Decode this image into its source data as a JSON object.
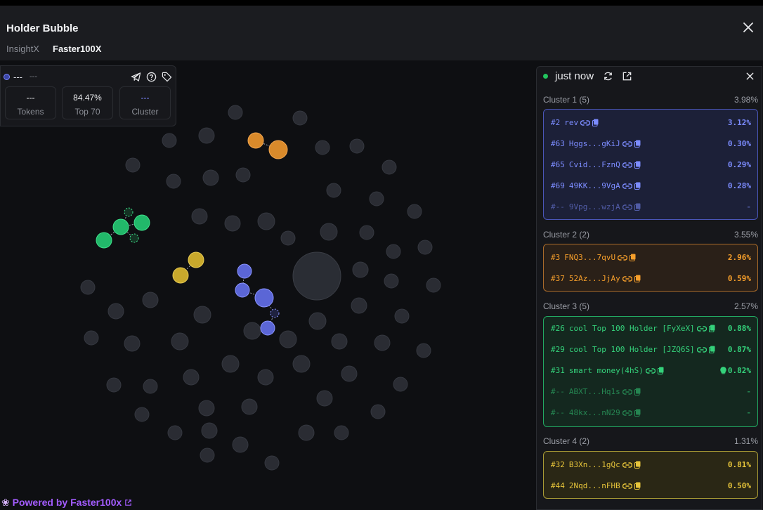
{
  "header": {
    "title": "Holder Bubble",
    "tabs": [
      "InsightX",
      "Faster100X"
    ]
  },
  "token_card": {
    "name": "---",
    "symbol": "---",
    "stats": [
      {
        "value": "---",
        "label": "Tokens"
      },
      {
        "value": "84.47%",
        "label": "Top 70"
      },
      {
        "value": "---",
        "label": "Cluster"
      }
    ],
    "icons": [
      "telegram-icon",
      "help-icon",
      "tag-icon"
    ]
  },
  "panel": {
    "status": "just now",
    "icons": [
      "refresh-icon",
      "external-link-icon",
      "close-icon"
    ],
    "clusters": [
      {
        "title": "Cluster 1 (5)",
        "percent": "3.98%",
        "rows": [
          {
            "rank": "#2",
            "address": "rev",
            "percent": "3.12%"
          },
          {
            "rank": "#63",
            "address": "Hggs...gKiJ",
            "percent": "0.30%"
          },
          {
            "rank": "#65",
            "address": "Cvid...FznQ",
            "percent": "0.29%"
          },
          {
            "rank": "#69",
            "address": "49KK...9VgA",
            "percent": "0.28%"
          },
          {
            "rank": "#--",
            "address": "9Vpg...wzjA",
            "percent": "-"
          }
        ]
      },
      {
        "title": "Cluster 2 (2)",
        "percent": "3.55%",
        "rows": [
          {
            "rank": "#3",
            "address": "FNQ3...7qvU",
            "percent": "2.96%"
          },
          {
            "rank": "#37",
            "address": "52Az...JjAy",
            "percent": "0.59%"
          }
        ]
      },
      {
        "title": "Cluster 3 (5)",
        "percent": "2.57%",
        "rows": [
          {
            "rank": "#26",
            "address": "cool Top 100 Holder [FyXeX]",
            "percent": "0.88%"
          },
          {
            "rank": "#29",
            "address": "cool Top 100 Holder [JZQ6S]",
            "percent": "0.87%"
          },
          {
            "rank": "#31",
            "address": "smart money(4hS)",
            "percent": "0.82%"
          },
          {
            "rank": "#--",
            "address": "ABXT...Hq1s",
            "percent": "-"
          },
          {
            "rank": "#--",
            "address": "48kx...nN29",
            "percent": "-"
          }
        ]
      },
      {
        "title": "Cluster 4 (2)",
        "percent": "1.31%",
        "rows": [
          {
            "rank": "#32",
            "address": "B3Xn...1gQc",
            "percent": "0.81%"
          },
          {
            "rank": "#44",
            "address": "2Nqd...nFHB",
            "percent": "0.50%"
          }
        ]
      }
    ]
  },
  "footer": {
    "prefix": "Powered by",
    "brand": "Faster100x"
  },
  "colors": {
    "cluster1": "#5b66d6",
    "cluster2": "#d98a2b",
    "cluster3": "#22b86a",
    "cluster4": "#c9a92c",
    "neutral_bubble": "#2a2c33"
  }
}
